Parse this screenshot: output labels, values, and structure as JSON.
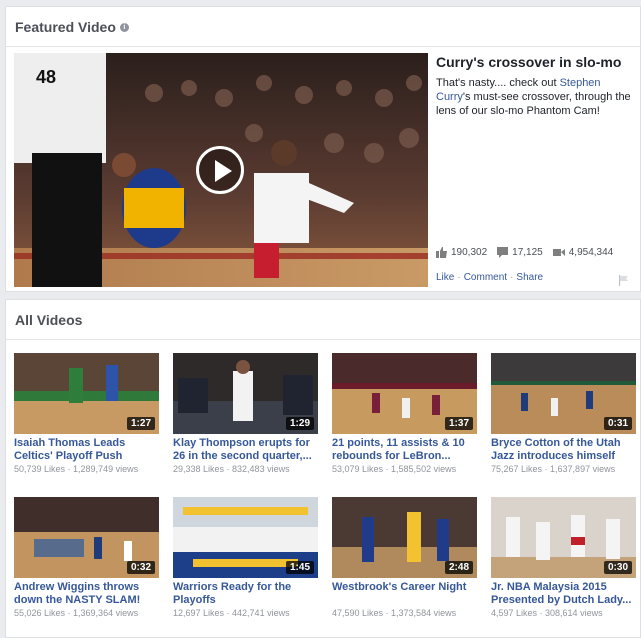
{
  "featured": {
    "section_title": "Featured Video",
    "jersey_number": "48",
    "video_title": "Curry's crossover in slo-mo",
    "desc_before": "That's nasty.... check out ",
    "desc_link": "Stephen Curry",
    "desc_after": "'s must-see crossover, through the lens of our slo-mo Phantom Cam!",
    "likes": "190,302",
    "comments": "17,125",
    "views": "4,954,344",
    "actions": {
      "like": "Like",
      "comment": "Comment",
      "share": "Share"
    }
  },
  "all_videos": {
    "section_title": "All Videos",
    "items": [
      {
        "title": "Isaiah Thomas Leads Celtics' Playoff Push",
        "duration": "1:27",
        "meta": "50,739 Likes · 1,289,749 views",
        "icon": "video-thumbnail"
      },
      {
        "title": "Klay Thompson erupts for 26 in the second quarter,...",
        "duration": "1:29",
        "meta": "29,338 Likes · 832,483 views",
        "icon": "video-thumbnail"
      },
      {
        "title": "21 points, 11 assists & 10 rebounds for LeBron...",
        "duration": "1:37",
        "meta": "53,079 Likes · 1,585,502 views",
        "icon": "video-thumbnail"
      },
      {
        "title": "Bryce Cotton of the Utah Jazz introduces himself to...",
        "duration": "0:31",
        "meta": "75,267 Likes · 1,637,897 views",
        "icon": "video-thumbnail"
      },
      {
        "title": "Andrew Wiggins throws down the NASTY SLAM!",
        "duration": "0:32",
        "meta": "55,026 Likes · 1,369,364 views",
        "icon": "video-thumbnail"
      },
      {
        "title": "Warriors Ready for the Playoffs",
        "duration": "1:45",
        "meta": "12,697 Likes · 442,741 views",
        "icon": "video-thumbnail"
      },
      {
        "title": "Westbrook's Career Night",
        "duration": "2:48",
        "meta": "47,590 Likes · 1,373,584 views",
        "icon": "video-thumbnail"
      },
      {
        "title": "Jr. NBA Malaysia 2015 Presented by Dutch Lady...",
        "duration": "0:30",
        "meta": "4,597 Likes · 308,614 views",
        "icon": "video-thumbnail"
      }
    ]
  },
  "colors": {
    "link": "#365899",
    "muted": "#90949c",
    "heading": "#4b4f56"
  }
}
